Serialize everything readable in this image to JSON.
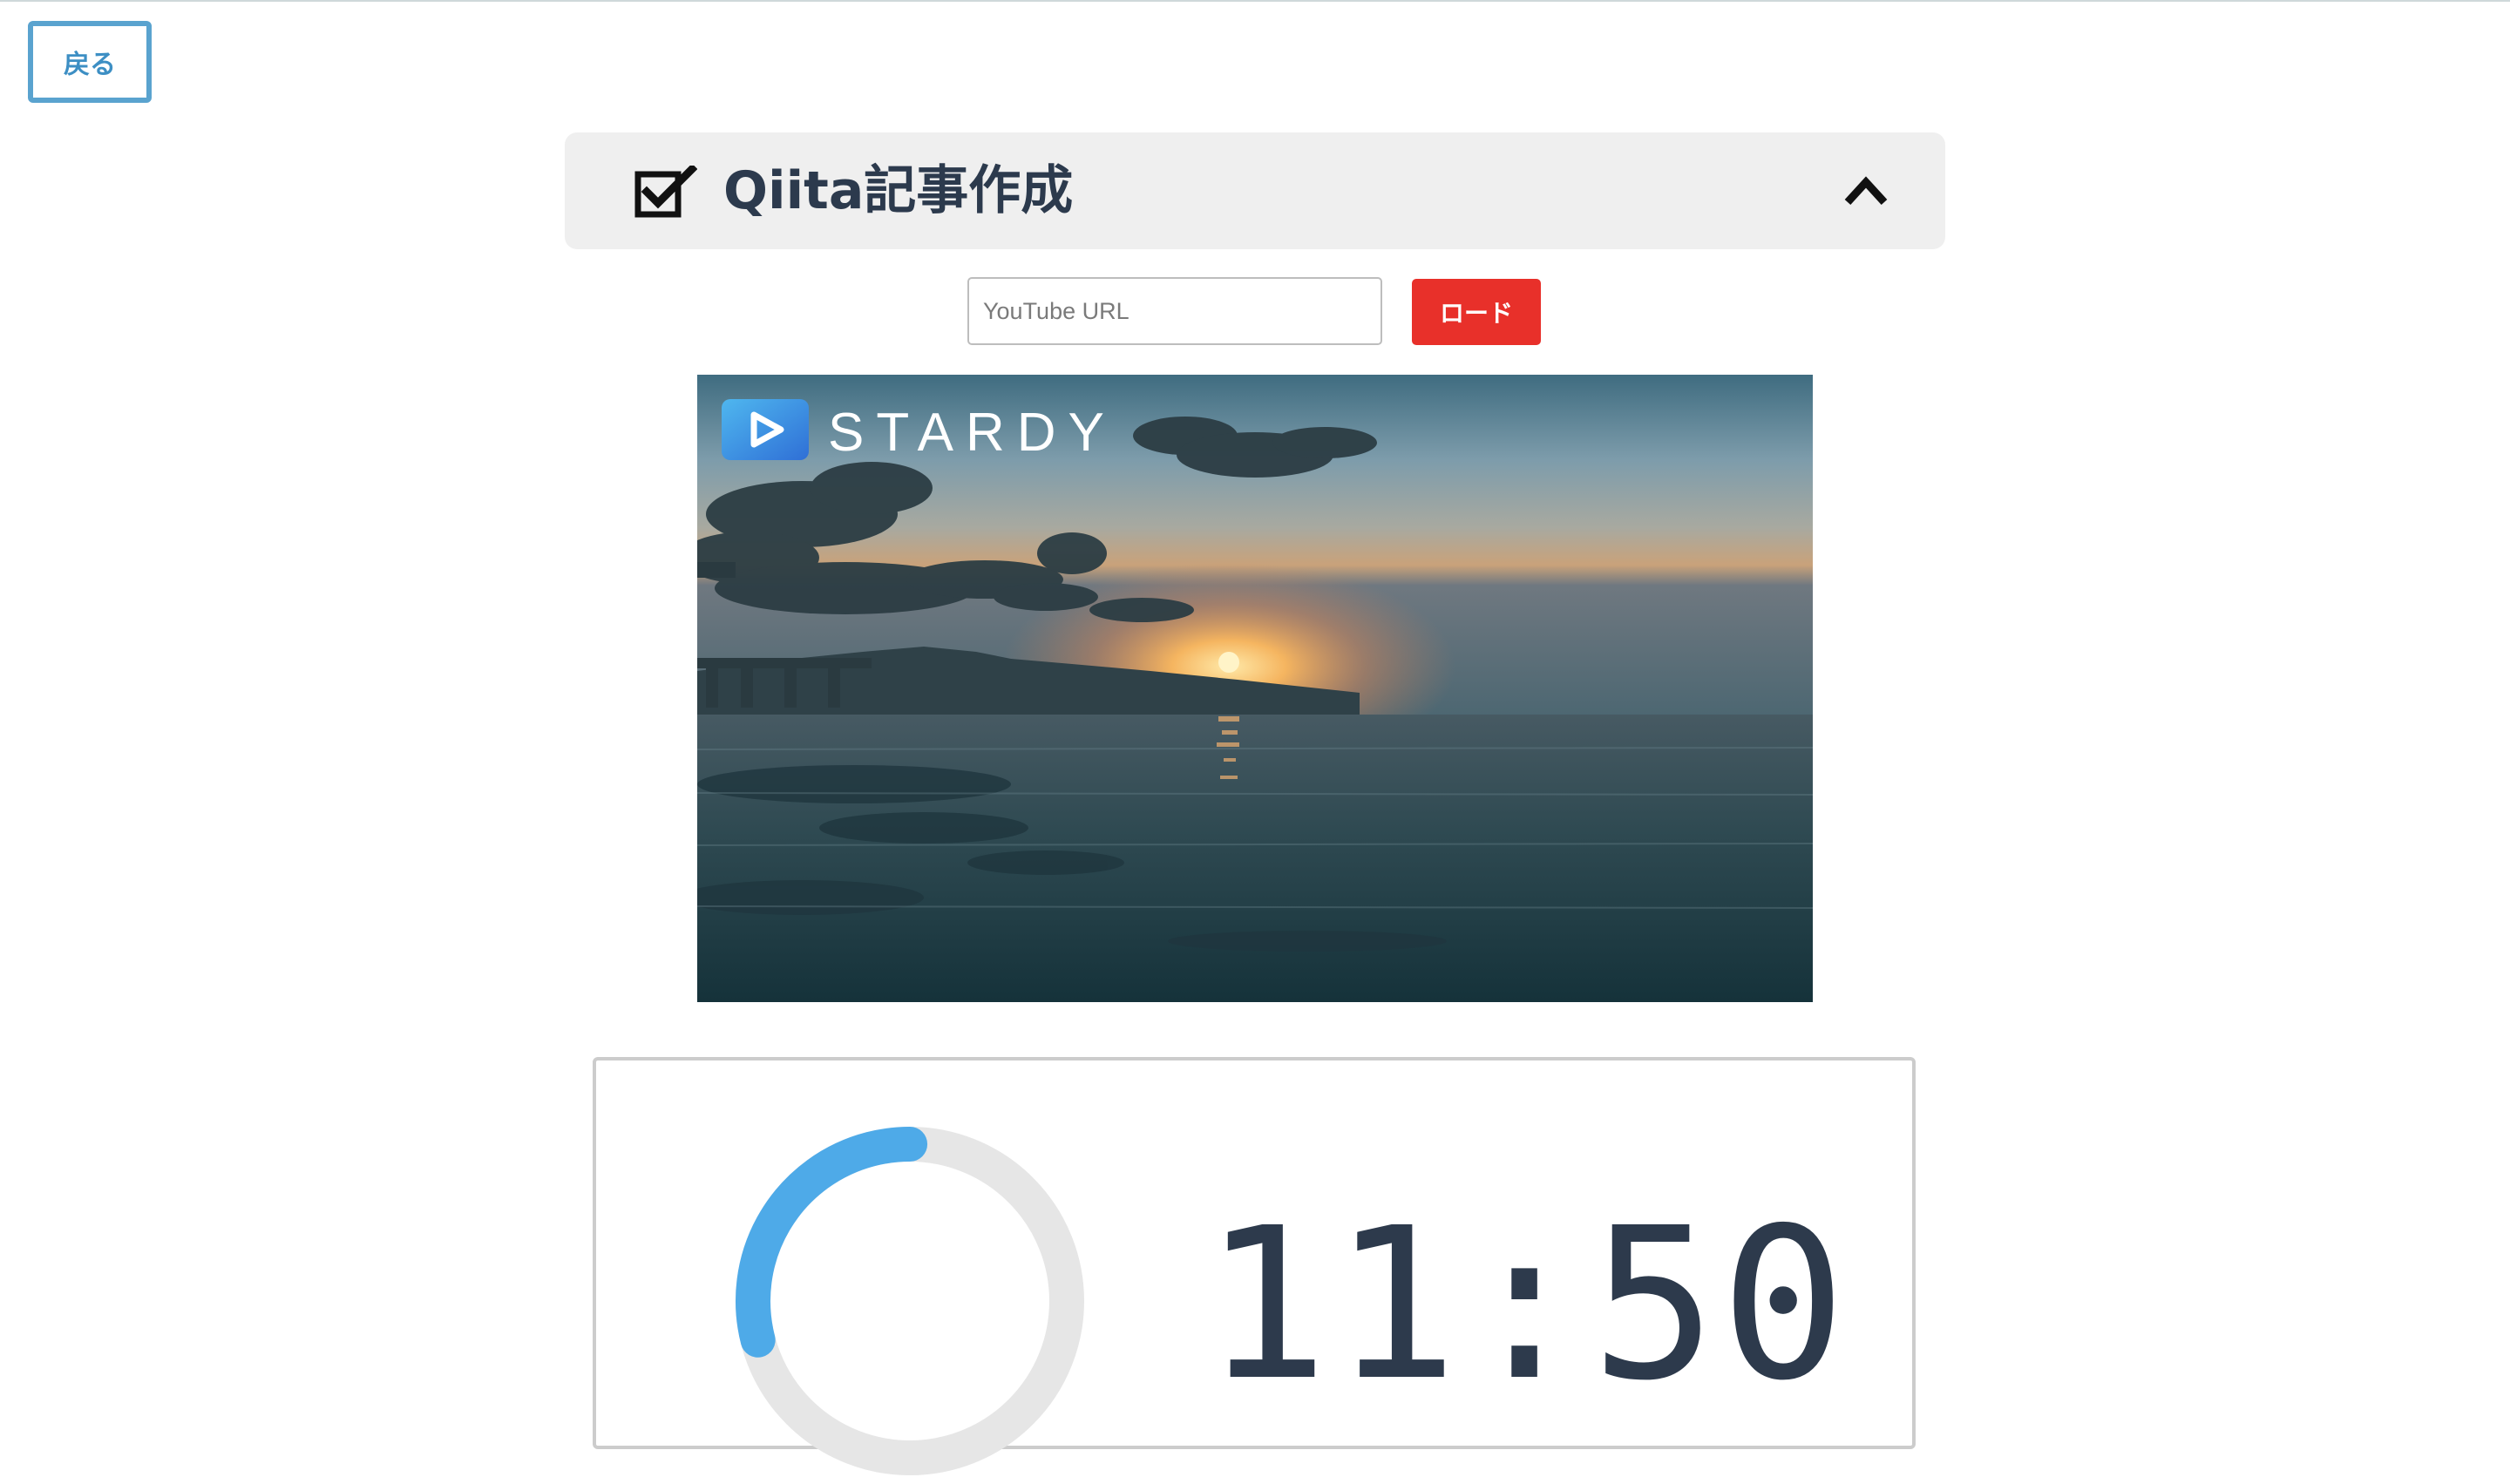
{
  "nav": {
    "back_label": "戻る"
  },
  "task": {
    "title": "Qiita記事作成",
    "icon": "checkbox-checked-icon",
    "toggle_icon": "chevron-up-icon"
  },
  "video_loader": {
    "url_placeholder": "YouTube URL",
    "url_value": "",
    "load_label": "ロード",
    "load_color": "#e8302a"
  },
  "video": {
    "brand_name": "STARDY",
    "brand_color": "#3d8fe0",
    "scene": "sunset over calm sea with clouds and mountains"
  },
  "timer": {
    "display": "11:50",
    "progress_fraction": 0.29,
    "ring_color": "#4eaae8",
    "track_color": "#e6e6e6"
  }
}
